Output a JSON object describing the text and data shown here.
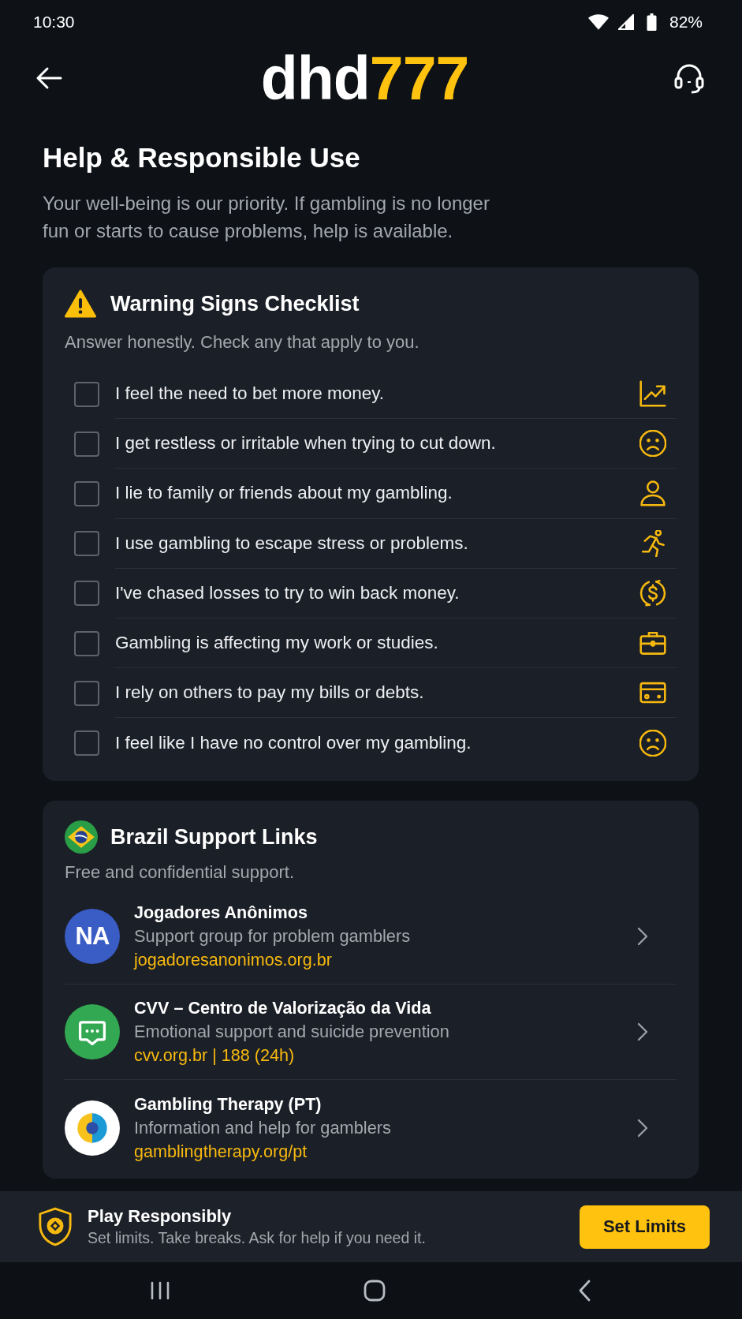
{
  "status_bar": {
    "time": "10:30",
    "battery": "82%"
  },
  "header": {
    "logo": {
      "main": "dhd",
      "accent": "777"
    }
  },
  "page": {
    "title": "Help & Responsible Use",
    "intro": "Your well-being is our priority. If gambling is no longer fun or starts to cause problems, help is available."
  },
  "checklist": {
    "title": "Warning Signs Checklist",
    "subtitle": "Answer honestly. Check any that apply to you.",
    "items": [
      {
        "text": "I feel the need to bet more money.",
        "checked": false
      },
      {
        "text": "I get restless or irritable when trying to cut down.",
        "checked": false
      },
      {
        "text": "I lie to family or friends about my gambling.",
        "checked": false
      },
      {
        "text": "I use gambling to escape stress or problems.",
        "checked": false
      },
      {
        "text": "I've chased losses to try to win back money.",
        "checked": false
      },
      {
        "text": "Gambling is affecting my work or studies.",
        "checked": false
      },
      {
        "text": "I rely on others to pay my bills or debts.",
        "checked": false
      },
      {
        "text": "I feel like I have no control over my gambling.",
        "checked": false
      }
    ]
  },
  "support": {
    "title": "Brazil Support Links",
    "subtitle": "Free and confidential support.",
    "links": [
      {
        "kind": "initials",
        "badge": "NA",
        "color": "#3a5cc5",
        "name": "Jogadores Anônimos",
        "description": "Support group for problem gamblers",
        "link": "jogadoresanonimos.org.br"
      },
      {
        "kind": "chat",
        "color": "#33a852",
        "name": "CVV – Centro de Valorização da Vida",
        "description": "Emotional support and suicide prevention",
        "link": "cvv.org.br | 188 (24h)"
      },
      {
        "kind": "logo",
        "color": "#ffffff",
        "name": "Gambling Therapy (PT)",
        "description": "Information and help for gamblers",
        "link": "gamblingtherapy.org/pt"
      }
    ]
  },
  "footer": {
    "title": "Play Responsibly",
    "text": "Set limits. Take breaks. Ask for help if you need it.",
    "button": "Set Limits"
  }
}
